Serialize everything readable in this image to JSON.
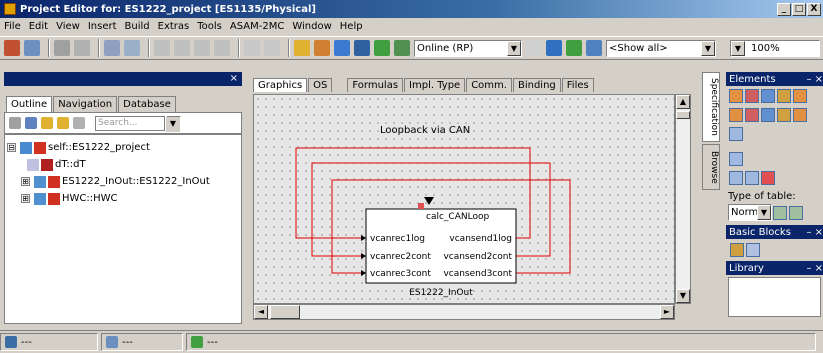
{
  "window": {
    "title": "Project Editor for: ES1222_project [ES1135/Physical]",
    "btn_min": "_",
    "btn_max": "□",
    "btn_close": "X"
  },
  "menu": [
    "File",
    "Edit",
    "View",
    "Insert",
    "Build",
    "Extras",
    "Tools",
    "ASAM-2MC",
    "Window",
    "Help"
  ],
  "toolbar": {
    "mode_select": "Online (RP)",
    "filter_select": "<Show all>",
    "zoom_select": "100%",
    "dropdown_arrow": "▼"
  },
  "left_panel": {
    "close_glyph": "×",
    "tabs": [
      "Outline",
      "Navigation",
      "Database"
    ],
    "search_placeholder": "Search...",
    "tree": [
      {
        "expander": "⊟",
        "label": "self::ES1222_project"
      },
      {
        "expander": "",
        "label": "dT::dT"
      },
      {
        "expander": "⊞",
        "label": "ES1222_InOut::ES1222_InOut"
      },
      {
        "expander": "⊞",
        "label": "HWC::HWC"
      }
    ]
  },
  "editor": {
    "tabs": [
      "Graphics",
      "OS",
      "Formulas",
      "Impl. Type",
      "Comm.",
      "Binding",
      "Files"
    ],
    "active_tab": "Graphics",
    "diagram": {
      "title": "Loopback via CAN",
      "process": "calc_CANLoop",
      "block_name": "ES1222_InOut",
      "inputs": [
        "vcanrec1log",
        "vcanrec2cont",
        "vcanrec3cont"
      ],
      "outputs": [
        "vcansend1log",
        "vcansend2cont",
        "vcansend3cont"
      ],
      "wire_color": "#e00000"
    },
    "scroll_up": "▲",
    "scroll_down": "▼",
    "scroll_left": "◄",
    "scroll_right": "►"
  },
  "side_tabs": [
    "Specification",
    "Browse"
  ],
  "right_panel": {
    "elements_title": "Elements",
    "elements_close": "–  ×",
    "type_of_table_label": "Type of table:",
    "table_type_value": "Normal",
    "basic_blocks_title": "Basic Blocks",
    "library_title": "Library"
  },
  "statusbar": [
    "---",
    "---",
    "---"
  ]
}
